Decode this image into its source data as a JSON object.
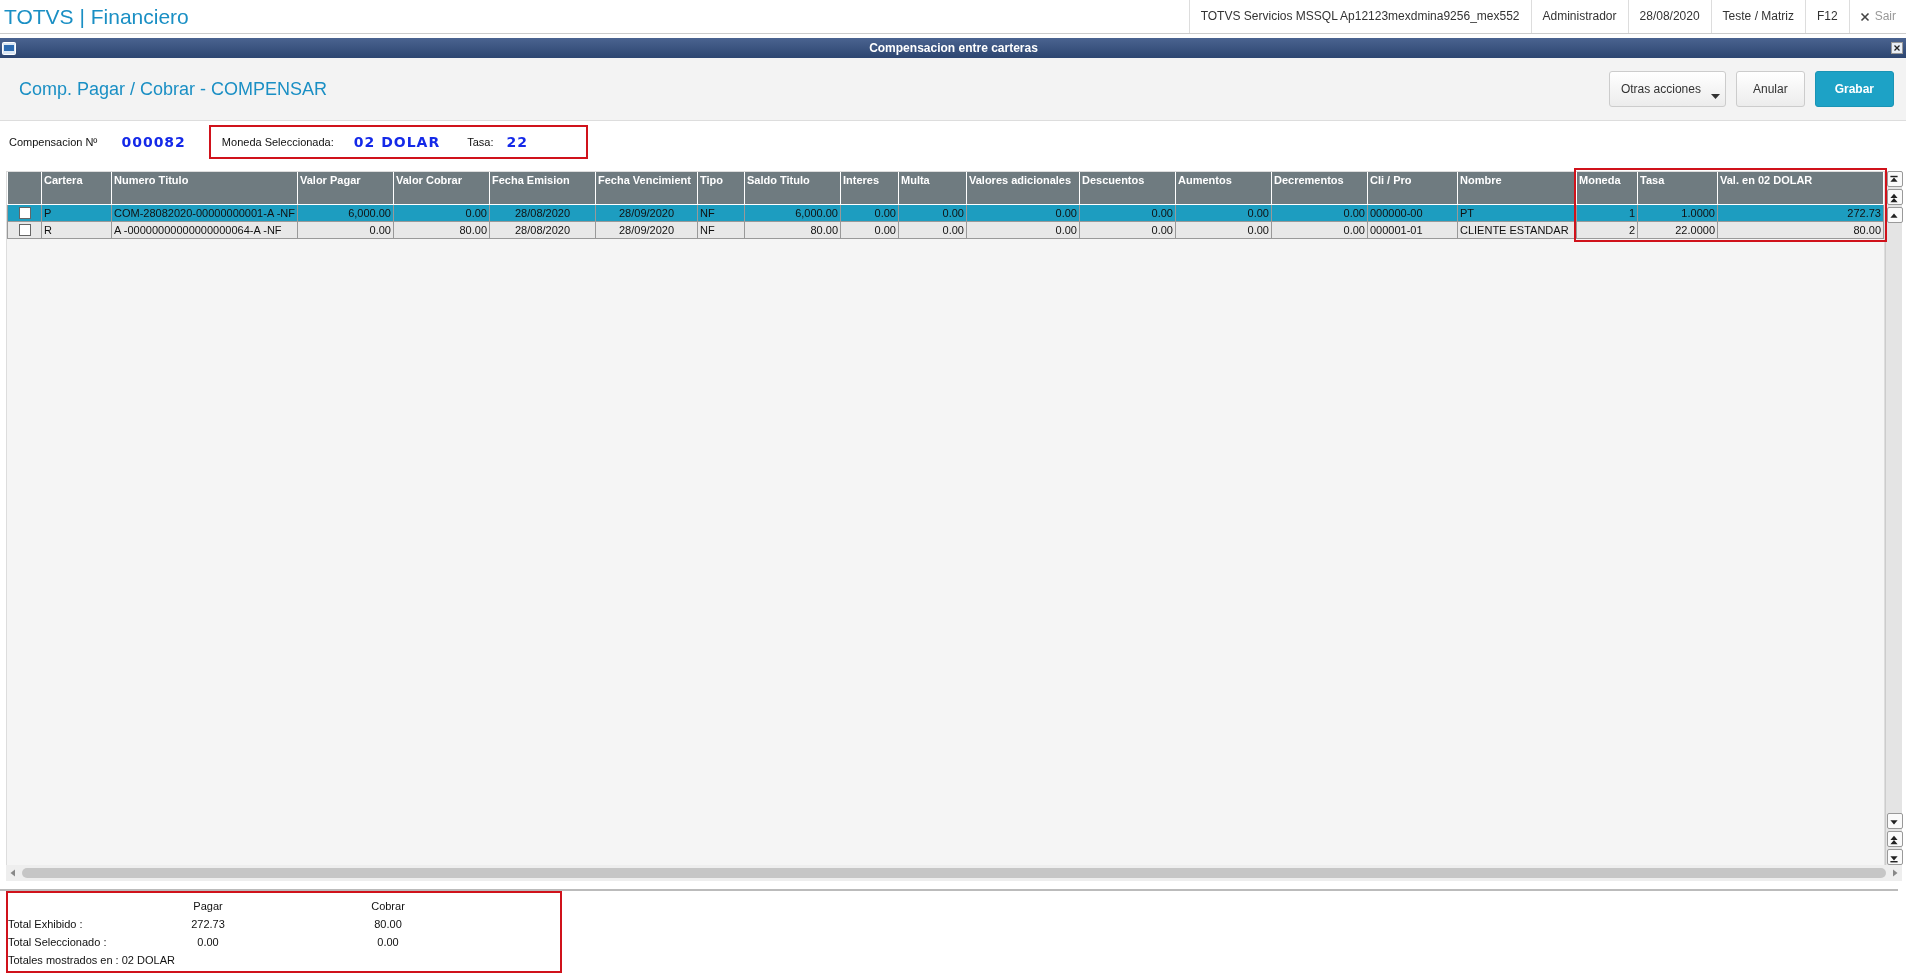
{
  "app": {
    "title": "TOTVS | Financiero"
  },
  "topbar": {
    "items": [
      "TOTVS Servicios MSSQL Ap12123mexdmina9256_mex552",
      "Administrador",
      "28/08/2020",
      "Teste / Matriz",
      "F12"
    ],
    "exit": {
      "label": "Sair",
      "disabled": true
    }
  },
  "window": {
    "title": "Compensacion entre carteras"
  },
  "page": {
    "title": "Comp. Pagar / Cobrar - COMPENSAR"
  },
  "buttons": [
    {
      "label": "Otras acciones",
      "kind": "menu"
    },
    {
      "label": "Anular",
      "kind": "default"
    },
    {
      "label": "Grabar",
      "kind": "primary"
    }
  ],
  "info": {
    "compensacion_label": "Compensacion Nº",
    "compensacion_value": "000082",
    "moneda_label": "Moneda Seleccionada:",
    "moneda_value": "02 DOLAR",
    "tasa_label": "Tasa:",
    "tasa_value": "22"
  },
  "table": {
    "columns": [
      {
        "label": "Cartera",
        "kind": "text"
      },
      {
        "label": "Numero Titulo",
        "kind": "text"
      },
      {
        "label": "Valor Pagar",
        "kind": "number"
      },
      {
        "label": "Valor Cobrar",
        "kind": "number"
      },
      {
        "label": "Fecha Emision",
        "kind": "date"
      },
      {
        "label": "Fecha Vencimient",
        "kind": "date"
      },
      {
        "label": "Tipo",
        "kind": "text"
      },
      {
        "label": "Saldo Titulo",
        "kind": "number"
      },
      {
        "label": "Interes",
        "kind": "number"
      },
      {
        "label": "Multa",
        "kind": "number"
      },
      {
        "label": "Valores adicionales",
        "kind": "number"
      },
      {
        "label": "Descuentos",
        "kind": "number"
      },
      {
        "label": "Aumentos",
        "kind": "number"
      },
      {
        "label": "Decrementos",
        "kind": "number"
      },
      {
        "label": "Cli / Pro",
        "kind": "text"
      },
      {
        "label": "Nombre",
        "kind": "text"
      },
      {
        "label": "Moneda",
        "kind": "number",
        "highlighted": true
      },
      {
        "label": "Tasa",
        "kind": "number",
        "highlighted": true
      },
      {
        "label": "Val. en 02 DOLAR",
        "kind": "number",
        "highlighted": true
      }
    ],
    "rows": [
      {
        "selected": true,
        "checked": false,
        "cells": [
          "P",
          "COM-28082020-00000000001-A -NF",
          "6,000.00",
          "0.00",
          "28/08/2020",
          "28/09/2020",
          "NF",
          "6,000.00",
          "0.00",
          "0.00",
          "0.00",
          "0.00",
          "0.00",
          "0.00",
          "000000-00",
          "PT",
          "1",
          "1.0000",
          "272.73"
        ]
      },
      {
        "selected": false,
        "checked": false,
        "cells": [
          "R",
          "A  -00000000000000000064-A -NF",
          "0.00",
          "80.00",
          "28/08/2020",
          "28/09/2020",
          "NF",
          "80.00",
          "0.00",
          "0.00",
          "0.00",
          "0.00",
          "0.00",
          "0.00",
          "000001-01",
          "CLIENTE ESTANDAR",
          "2",
          "22.0000",
          "80.00"
        ]
      }
    ]
  },
  "totals": {
    "headers": [
      "Pagar",
      "Cobrar"
    ],
    "rows": [
      {
        "label": "Total Exhibido :",
        "values": [
          "272.73",
          "80.00"
        ]
      },
      {
        "label": "Total Seleccionado :",
        "values": [
          "0.00",
          "0.00"
        ]
      }
    ],
    "footer": "Totales mostrados en : 02 DOLAR"
  }
}
